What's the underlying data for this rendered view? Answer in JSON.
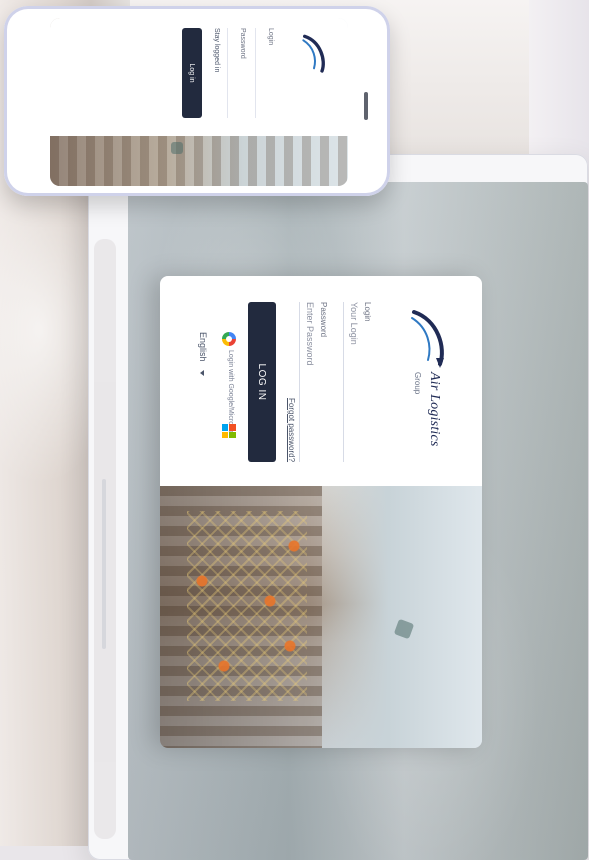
{
  "laptop": {
    "app": {
      "brand_name": "Air Logistics",
      "brand_suffix": "Group",
      "login_label": "Login",
      "login_placeholder": "Your Login",
      "password_label": "Password",
      "password_placeholder": "Enter Password",
      "forgot_password": "Forgot password?",
      "login_button": "LOG IN",
      "sso_text": "Login with Google/Microsoft",
      "language": "English"
    }
  },
  "phone": {
    "app": {
      "login_label": "Login",
      "password_label": "Password",
      "stay_logged_in": "Stay logged in",
      "login_button": "Log in"
    }
  },
  "colors": {
    "primary_button": "#222a3e",
    "brand_navy": "#202b55",
    "background": "#e9e6ea"
  }
}
